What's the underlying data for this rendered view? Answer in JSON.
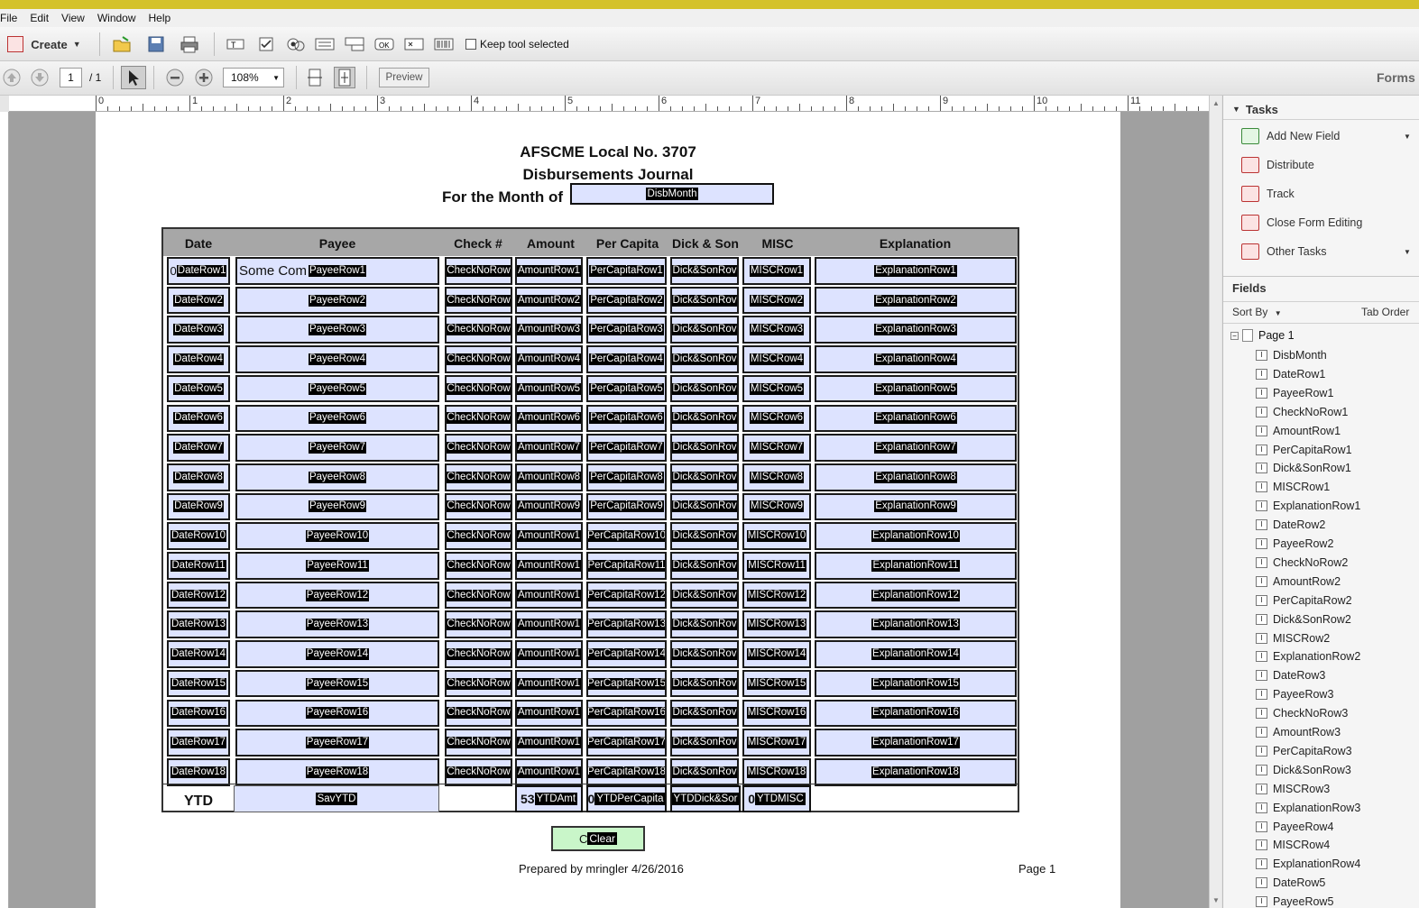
{
  "menu": [
    "File",
    "Edit",
    "View",
    "Window",
    "Help"
  ],
  "toolbar": {
    "create_label": "Create",
    "keep_tool_label": "Keep tool selected",
    "page_current": "1",
    "page_total": "/ 1",
    "zoom": "108%",
    "preview_label": "Preview",
    "forms_label": "Forms"
  },
  "ruler": [
    "0",
    "1",
    "2",
    "3",
    "4",
    "5",
    "6",
    "7",
    "8",
    "9",
    "10",
    "11"
  ],
  "doc": {
    "title1": "AFSCME Local No. 3707",
    "title2": "Disbursements Journal",
    "month_label": "For the Month of",
    "month_field": "DisbMonth",
    "headers": [
      "Date",
      "Payee",
      "Check #",
      "Amount",
      "Per Capita",
      "Dick & Son",
      "MISC",
      "Explanation"
    ],
    "row1_date_prefix": "0",
    "row1_payee_prefix": "Some Com",
    "rows": [
      [
        "DateRow1",
        "PayeeRow1",
        "CheckNoRow",
        "AmountRow1",
        "PerCapitaRow1",
        "Dick&SonRov",
        "MISCRow1",
        "ExplanationRow1"
      ],
      [
        "DateRow2",
        "PayeeRow2",
        "CheckNoRow",
        "AmountRow2",
        "PerCapitaRow2",
        "Dick&SonRov",
        "MISCRow2",
        "ExplanationRow2"
      ],
      [
        "DateRow3",
        "PayeeRow3",
        "CheckNoRow",
        "AmountRow3",
        "PerCapitaRow3",
        "Dick&SonRov",
        "MISCRow3",
        "ExplanationRow3"
      ],
      [
        "DateRow4",
        "PayeeRow4",
        "CheckNoRow",
        "AmountRow4",
        "PerCapitaRow4",
        "Dick&SonRov",
        "MISCRow4",
        "ExplanationRow4"
      ],
      [
        "DateRow5",
        "PayeeRow5",
        "CheckNoRow",
        "AmountRow5",
        "PerCapitaRow5",
        "Dick&SonRov",
        "MISCRow5",
        "ExplanationRow5"
      ],
      [
        "DateRow6",
        "PayeeRow6",
        "CheckNoRow",
        "AmountRow6",
        "PerCapitaRow6",
        "Dick&SonRov",
        "MISCRow6",
        "ExplanationRow6"
      ],
      [
        "DateRow7",
        "PayeeRow7",
        "CheckNoRow",
        "AmountRow7",
        "PerCapitaRow7",
        "Dick&SonRov",
        "MISCRow7",
        "ExplanationRow7"
      ],
      [
        "DateRow8",
        "PayeeRow8",
        "CheckNoRow",
        "AmountRow8",
        "PerCapitaRow8",
        "Dick&SonRov",
        "MISCRow8",
        "ExplanationRow8"
      ],
      [
        "DateRow9",
        "PayeeRow9",
        "CheckNoRow",
        "AmountRow9",
        "PerCapitaRow9",
        "Dick&SonRov",
        "MISCRow9",
        "ExplanationRow9"
      ],
      [
        "DateRow10",
        "PayeeRow10",
        "CheckNoRow",
        "AmountRow1",
        "PerCapitaRow10",
        "Dick&SonRov",
        "MISCRow10",
        "ExplanationRow10"
      ],
      [
        "DateRow11",
        "PayeeRow11",
        "CheckNoRow",
        "AmountRow1",
        "PerCapitaRow11",
        "Dick&SonRov",
        "MISCRow11",
        "ExplanationRow11"
      ],
      [
        "DateRow12",
        "PayeeRow12",
        "CheckNoRow",
        "AmountRow1",
        "PerCapitaRow12",
        "Dick&SonRov",
        "MISCRow12",
        "ExplanationRow12"
      ],
      [
        "DateRow13",
        "PayeeRow13",
        "CheckNoRow",
        "AmountRow1",
        "PerCapitaRow13",
        "Dick&SonRov",
        "MISCRow13",
        "ExplanationRow13"
      ],
      [
        "DateRow14",
        "PayeeRow14",
        "CheckNoRow",
        "AmountRow1",
        "PerCapitaRow14",
        "Dick&SonRov",
        "MISCRow14",
        "ExplanationRow14"
      ],
      [
        "DateRow15",
        "PayeeRow15",
        "CheckNoRow",
        "AmountRow1",
        "PerCapitaRow15",
        "Dick&SonRov",
        "MISCRow15",
        "ExplanationRow15"
      ],
      [
        "DateRow16",
        "PayeeRow16",
        "CheckNoRow",
        "AmountRow1",
        "PerCapitaRow16",
        "Dick&SonRov",
        "MISCRow16",
        "ExplanationRow16"
      ],
      [
        "DateRow17",
        "PayeeRow17",
        "CheckNoRow",
        "AmountRow1",
        "PerCapitaRow17",
        "Dick&SonRov",
        "MISCRow17",
        "ExplanationRow17"
      ],
      [
        "DateRow18",
        "PayeeRow18",
        "CheckNoRow",
        "AmountRow1",
        "PerCapitaRow18",
        "Dick&SonRov",
        "MISCRow18",
        "ExplanationRow18"
      ]
    ],
    "ytd_label": "YTD",
    "ytd_fields": [
      "SavYTD",
      "YTDAmt",
      "YTDPerCapita",
      "YTDDick&Sor",
      "YTDMISC"
    ],
    "ytd_amt_prefix": "53",
    "ytd_percap_prefix": "0",
    "ytd_misc_prefix": "0",
    "clear_label": "Clear",
    "clear_prefix": "C",
    "prepared_by": "Prepared by mringler 4/26/2016",
    "page_label": "Page 1"
  },
  "panel": {
    "tasks_header": "Tasks",
    "tasks": [
      "Add New Field",
      "Distribute",
      "Track",
      "Close Form Editing",
      "Other Tasks"
    ],
    "fields_header": "Fields",
    "sort_by": "Sort By",
    "tab_order": "Tab Order",
    "page_node": "Page 1",
    "fields": [
      "DisbMonth",
      "DateRow1",
      "PayeeRow1",
      "CheckNoRow1",
      "AmountRow1",
      "PerCapitaRow1",
      "Dick&SonRow1",
      "MISCRow1",
      "ExplanationRow1",
      "DateRow2",
      "PayeeRow2",
      "CheckNoRow2",
      "AmountRow2",
      "PerCapitaRow2",
      "Dick&SonRow2",
      "MISCRow2",
      "ExplanationRow2",
      "DateRow3",
      "PayeeRow3",
      "CheckNoRow3",
      "AmountRow3",
      "PerCapitaRow3",
      "Dick&SonRow3",
      "MISCRow3",
      "ExplanationRow3",
      "PayeeRow4",
      "MISCRow4",
      "ExplanationRow4",
      "DateRow5",
      "PayeeRow5"
    ]
  }
}
